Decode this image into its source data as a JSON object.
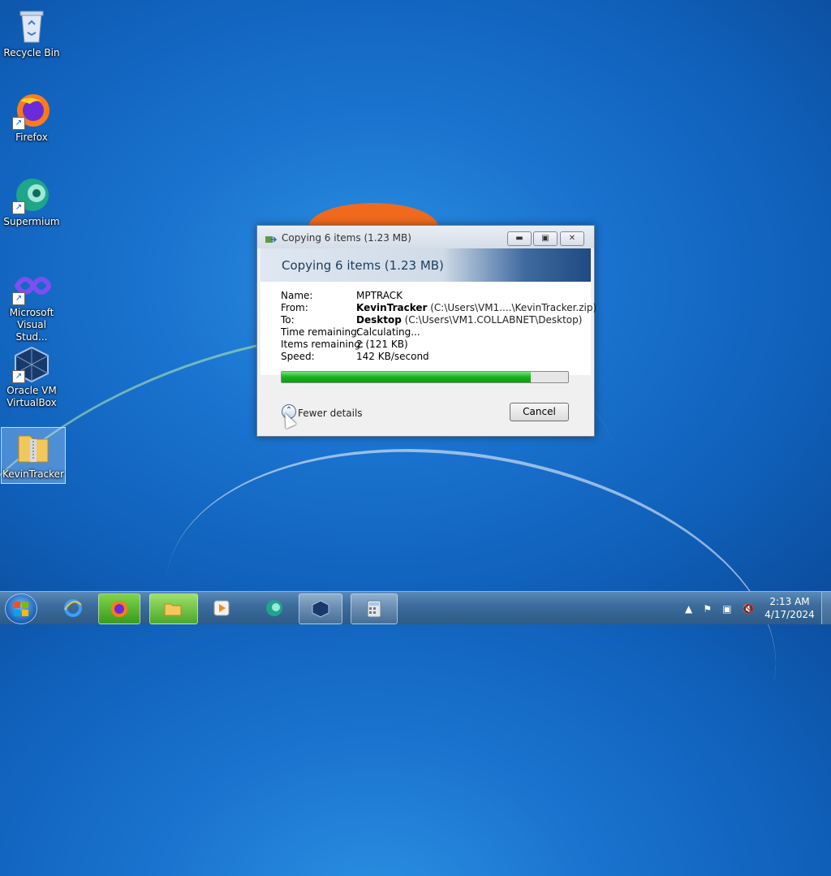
{
  "desktop": {
    "icons": [
      {
        "label": "Recycle Bin"
      },
      {
        "label": "Firefox"
      },
      {
        "label": "Supermium"
      },
      {
        "label": "Microsoft Visual Stud..."
      },
      {
        "label": "Oracle VM VirtualBox"
      },
      {
        "label": "KevinTracker"
      }
    ]
  },
  "dialog": {
    "title": "Copying 6 items (1.23 MB)",
    "header": "Copying 6 items (1.23 MB)",
    "name_label": "Name:",
    "name_value": "MPTRACK",
    "from_label": "From:",
    "from_bold": "KevinTracker",
    "from_path": "(C:\\Users\\VM1....\\KevinTracker.zip)",
    "to_label": "To:",
    "to_bold": "Desktop",
    "to_path": "(C:\\Users\\VM1.COLLABNET\\Desktop)",
    "time_label": "Time remaining:",
    "time_value": "Calculating...",
    "items_label": "Items remaining:",
    "items_value": "2 (121 KB)",
    "speed_label": "Speed:",
    "speed_value": "142 KB/second",
    "progress_fraction": 0.87,
    "fewer_details": "Fewer details",
    "cancel": "Cancel"
  },
  "taskbar": {
    "clock_time": "2:13 AM",
    "clock_date": "4/17/2024",
    "apps": [
      "start-button",
      "internet-explorer",
      "firefox",
      "file-explorer",
      "media-player",
      "supermium",
      "virtualbox",
      "calculator"
    ]
  },
  "colors": {
    "progress_green": "#14b31c",
    "taskbar": "#3d6d9e"
  }
}
